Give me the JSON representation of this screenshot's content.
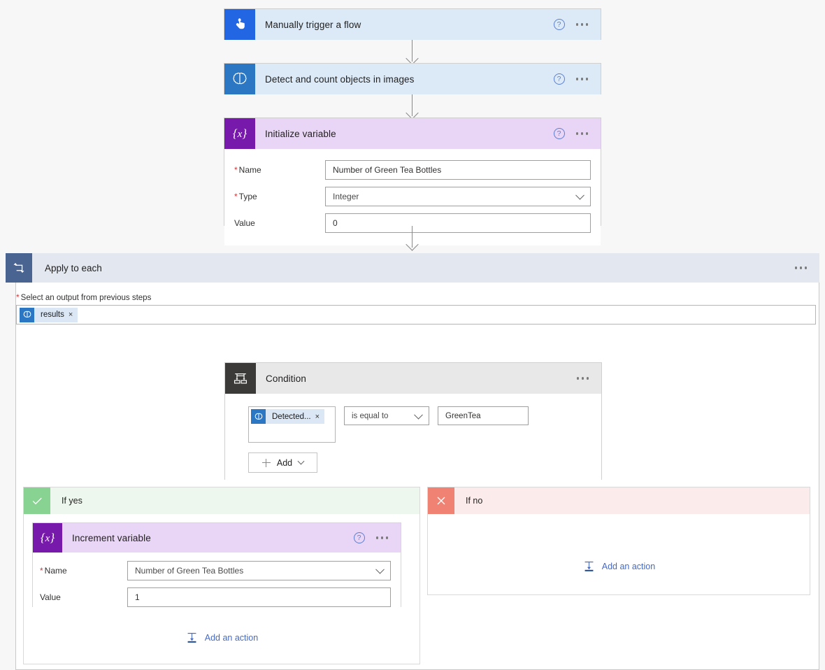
{
  "flow": {
    "steps": [
      {
        "id": "trigger",
        "title": "Manually trigger a flow",
        "icon": "tap-hand-icon",
        "icon_bg": "#2266E3",
        "has_help": true,
        "has_menu": true
      },
      {
        "id": "detect",
        "title": "Detect and count objects in images",
        "icon": "ai-brain-icon",
        "icon_bg": "#2B77C4",
        "has_help": true,
        "has_menu": true
      },
      {
        "id": "init_var",
        "title": "Initialize variable",
        "icon": "variable-icon",
        "icon_bg": "#7719AA",
        "has_help": true,
        "has_menu": true
      }
    ]
  },
  "initialize_variable": {
    "title": "Initialize variable",
    "fields": [
      {
        "label": "Name",
        "required": true,
        "value": "Number of Green Tea Bottles",
        "type": "text"
      },
      {
        "label": "Type",
        "required": true,
        "value": "Integer",
        "type": "select"
      },
      {
        "label": "Value",
        "required": false,
        "value": "0",
        "type": "text"
      }
    ]
  },
  "apply_to_each": {
    "title": "Apply to each",
    "icon": "loop-icon",
    "field_label": "Select an output from previous steps",
    "field_required": true,
    "token": {
      "label": "results",
      "icon": "ai-brain-icon",
      "remove": "×"
    },
    "has_menu": true
  },
  "condition": {
    "title": "Condition",
    "icon": "condition-icon",
    "has_menu": true,
    "left_token": {
      "label": "Detected...",
      "icon": "ai-brain-icon",
      "remove": "×"
    },
    "operator": "is equal to",
    "right_value": "GreenTea",
    "add_button": "Add"
  },
  "branches": {
    "yes": {
      "title": "If yes",
      "icon": "checkmark-icon",
      "icon_bg": "#88d392",
      "header_bg": "#edf7ee",
      "add_action": "Add an action",
      "action_card": {
        "title": "Increment variable",
        "icon": "variable-icon",
        "icon_bg": "#7719AA",
        "has_help": true,
        "has_menu": true,
        "fields": [
          {
            "label": "Name",
            "required": true,
            "value": "Number of Green Tea Bottles",
            "type": "select"
          },
          {
            "label": "Value",
            "required": false,
            "value": "1",
            "type": "text"
          }
        ]
      }
    },
    "no": {
      "title": "If no",
      "icon": "close-x-icon",
      "icon_bg": "#ef8272",
      "header_bg": "#fbeceb",
      "add_action": "Add an action"
    }
  },
  "colors": {
    "accent_blue": "#4569c4",
    "variable_purple": "#7719AA",
    "variable_header": "#e9d5f5",
    "trigger_blue": "#2266E3",
    "trigger_header": "#dceaf8",
    "loop_blue": "#4a6491",
    "condition_gray": "#3B3A39",
    "required_red": "#d13438"
  }
}
